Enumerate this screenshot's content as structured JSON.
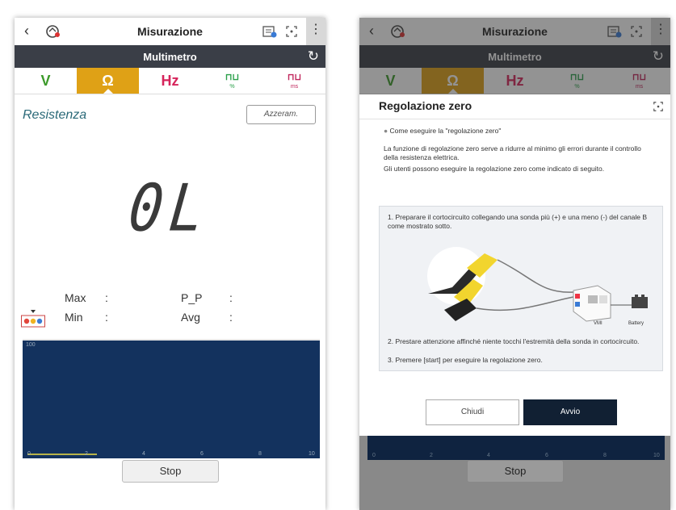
{
  "left": {
    "header": {
      "title": "Misurazione",
      "back": "‹",
      "kebab": "⋮"
    },
    "mode": {
      "title": "Multimetro",
      "refresh": "↻"
    },
    "tabs": [
      {
        "label": "V"
      },
      {
        "label": "Ω"
      },
      {
        "label": "Hz"
      },
      {
        "label": "⊓⊔",
        "sub": "%"
      },
      {
        "label": "⊓⊔",
        "sub": "ms"
      }
    ],
    "measure_label": "Resistenza",
    "zero_button": "Azzeram.",
    "reading": "0L",
    "stats": {
      "max": "Max",
      "min": "Min",
      "pp": "P_P",
      "avg": "Avg",
      "colon": ":"
    },
    "plot": {
      "y_top": "100",
      "x_ticks": [
        "0",
        "2",
        "4",
        "6",
        "8",
        "10"
      ]
    },
    "stop": "Stop",
    "colors": {
      "accent": "#dfa116",
      "plot_bg": "#13325e",
      "mode_bar": "#3a3e47"
    }
  },
  "right": {
    "header": {
      "title": "Misurazione",
      "back": "‹",
      "kebab": "⋮"
    },
    "mode": {
      "title": "Multimetro",
      "refresh": "↻"
    },
    "tabs": [
      {
        "label": "V"
      },
      {
        "label": "Ω"
      },
      {
        "label": "Hz"
      },
      {
        "label": "⊓⊔",
        "sub": "%"
      },
      {
        "label": "⊓⊔",
        "sub": "ms"
      }
    ],
    "dialog": {
      "title": "Regolazione zero",
      "bullet": "Come eseguire la \"regolazione zero\"",
      "para1": "La funzione di regolazione zero serve a ridurre al minimo gli errori durante il controllo della resistenza elettrica.",
      "para2": "Gli utenti possono eseguire la regolazione zero come indicato di seguito.",
      "step1": "1. Preparare il cortocircuito collegando una sonda più (+) e una meno (-) del canale B come mostrato sotto.",
      "step2": "2. Prestare attenzione affinché niente tocchi l'estremità della sonda in cortocircuito.",
      "step3": "3. Premere [start] per eseguire la regolazione zero.",
      "vmi_label": "VMI",
      "battery_label": "Battery",
      "close": "Chiudi",
      "start": "Avvio"
    },
    "plot": {
      "x_ticks": [
        "0",
        "2",
        "4",
        "6",
        "8",
        "10"
      ]
    },
    "stop": "Stop"
  }
}
